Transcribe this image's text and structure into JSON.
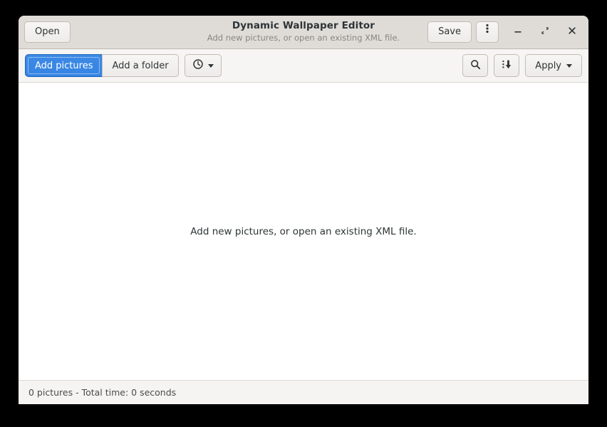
{
  "window": {
    "title": "Dynamic Wallpaper Editor",
    "subtitle": "Add new pictures, or open an existing XML file."
  },
  "headerbar": {
    "open_label": "Open",
    "save_label": "Save",
    "menu_icon": "vertical-dots-icon",
    "minimize_icon": "minimize-icon",
    "maximize_icon": "maximize-icon",
    "close_icon": "close-icon"
  },
  "toolbar": {
    "add_pictures_label": "Add pictures",
    "add_folder_label": "Add a folder",
    "time_icon": "clock-icon",
    "time_caret_icon": "chevron-down-icon",
    "search_icon": "search-icon",
    "sort_icon": "sort-descending-icon",
    "apply_label": "Apply",
    "apply_caret_icon": "chevron-down-icon"
  },
  "content": {
    "empty_message": "Add new pictures, or open an existing XML file."
  },
  "statusbar": {
    "summary": "0 pictures - Total time: 0 seconds"
  },
  "colors": {
    "accent": "#3584e4",
    "headerbar": "#dfdcd8",
    "toolbar": "#f6f5f4",
    "content": "#ffffff",
    "statusbar": "#f5f4f2"
  }
}
